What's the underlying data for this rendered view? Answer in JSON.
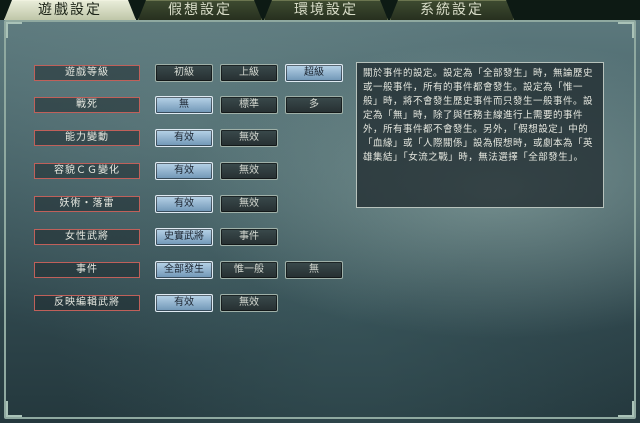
{
  "tabs": [
    {
      "label": "遊戲設定",
      "active": true
    },
    {
      "label": "假想設定",
      "active": false
    },
    {
      "label": "環境設定",
      "active": false
    },
    {
      "label": "系統設定",
      "active": false
    }
  ],
  "settings": [
    {
      "label": "遊戲等級",
      "options": [
        "初級",
        "上級",
        "超級"
      ],
      "selected": 2
    },
    {
      "label": "戰死",
      "options": [
        "無",
        "標準",
        "多"
      ],
      "selected": 0
    },
    {
      "label": "能力變動",
      "options": [
        "有效",
        "無效"
      ],
      "selected": 0
    },
    {
      "label": "容貌ＣＧ變化",
      "options": [
        "有效",
        "無效"
      ],
      "selected": 0
    },
    {
      "label": "妖術・落雷",
      "options": [
        "有效",
        "無效"
      ],
      "selected": 0
    },
    {
      "label": "女性武將",
      "options": [
        "史實武將",
        "事件"
      ],
      "selected": 0
    },
    {
      "label": "事件",
      "options": [
        "全部發生",
        "惟一般",
        "無"
      ],
      "selected": 0
    },
    {
      "label": "反映編輯武將",
      "options": [
        "有效",
        "無效"
      ],
      "selected": 0
    }
  ],
  "description": "關於事件的設定。設定為「全部發生」時，無論歷史或一般事件，所有的事件都會發生。設定為「惟一般」時，將不會發生歷史事件而只發生一般事件。設定為「無」時，除了與任務主線進行上需要的事件外，所有事件都不會發生。另外，「假想設定」中的「血緣」或「人際關係」設為假想時，或劇本為「英雄集結」「女流之戰」時，無法選擇「全部發生」。"
}
